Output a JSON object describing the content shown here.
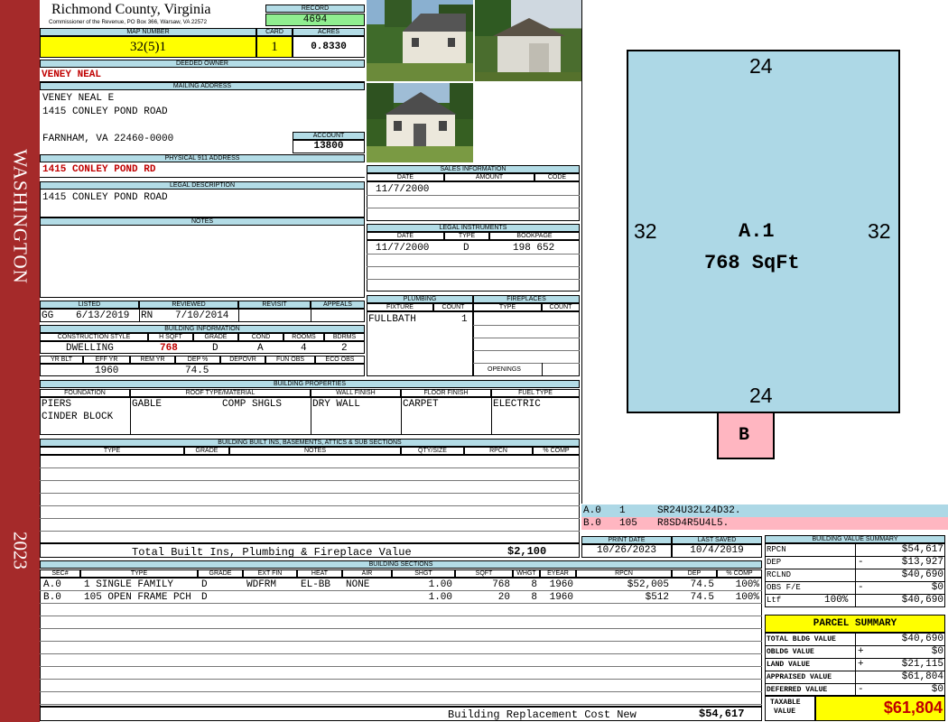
{
  "side": {
    "top": "WASHINGTON",
    "bottom": "2023"
  },
  "header": {
    "county": "Richmond County, Virginia",
    "address_line": "Commissioner of the Revenue, PO Box 366, Warsaw, VA 22572",
    "record_label": "RECORD",
    "record_value": "4694",
    "map_label": "MAP NUMBER",
    "map_value": "32(5)1",
    "card_label": "CARD",
    "card_value": "1",
    "acres_label": "ACRES",
    "acres_value": "0.8330"
  },
  "owner": {
    "deeded_label": "DEEDED OWNER",
    "deeded_value": "VENEY NEAL",
    "mailing_label": "MAILING ADDRESS",
    "mail_line1": "VENEY NEAL E",
    "mail_line2": "1415 CONLEY POND ROAD",
    "mail_line3": "FARNHAM, VA 22460-0000",
    "account_label": "ACCOUNT",
    "account_value": "13800",
    "physical_label": "PHYSICAL 911 ADDRESS",
    "physical_value": "1415 CONLEY POND RD",
    "legal_label": "LEGAL DESCRIPTION",
    "legal_value": "1415 CONLEY POND ROAD",
    "notes_label": "NOTES"
  },
  "listed": {
    "listed_label": "LISTED",
    "reviewed_label": "REVIEWED",
    "revisit_label": "REVISIT",
    "appeals_label": "APPEALS",
    "listed_by": "GG",
    "listed_date": "6/13/2019",
    "reviewed_by": "RN",
    "reviewed_date": "7/10/2014"
  },
  "building_info": {
    "label": "BUILDING INFORMATION",
    "h1": "CONSTRUCTION STYLE",
    "h2": "H SQFT",
    "h3": "GRADE",
    "h4": "COND",
    "h5": "ROOMS",
    "h6": "BDRMS",
    "style": "DWELLING",
    "hsqft": "768",
    "grade": "D",
    "cond": "A",
    "rooms": "4",
    "bdrms": "2",
    "h7": "YR BLT",
    "h8": "EFF YR",
    "h9": "REM YR",
    "h10": "DEP %",
    "h11": "DEPOVR",
    "h12": "FUN OBS",
    "h13": "ECO OBS",
    "eff_yr": "1960",
    "dep": "74.5"
  },
  "sales": {
    "label": "SALES INFORMATION",
    "date_label": "DATE",
    "amount_label": "AMOUNT",
    "code_label": "CODE",
    "date": "11/7/2000"
  },
  "legal_instr": {
    "label": "LEGAL INSTRUMENTS",
    "date_label": "DATE",
    "type_label": "TYPE",
    "book_label": "BOOKPAGE",
    "date": "11/7/2000",
    "type": "D",
    "book": "198 652"
  },
  "plumbing": {
    "label": "PLUMBING",
    "fixture_label": "FIXTURE",
    "count_label": "COUNT",
    "fixture": "FULLBATH",
    "count": "1"
  },
  "fireplaces": {
    "label": "FIREPLACES",
    "type_label": "TYPE",
    "count_label": "COUNT",
    "openings_label": "OPENINGS"
  },
  "bprops": {
    "label": "BUILDING PROPERTIES",
    "foundation_label": "FOUNDATION",
    "roof_label": "ROOF TYPE/MATERIAL",
    "wall_label": "WALL FINISH",
    "floor_label": "FLOOR FINISH",
    "fuel_label": "FUEL TYPE",
    "foundation1": "PIERS",
    "foundation2": "CINDER BLOCK",
    "roof_type": "GABLE",
    "roof_mat": "COMP SHGLS",
    "wall": "DRY WALL",
    "floor": "CARPET",
    "fuel": "ELECTRIC"
  },
  "builtins": {
    "label": "BUILDING BUILT INS, BASEMENTS, ATTICS & SUB SECTIONS",
    "type_label": "TYPE",
    "grade_label": "GRADE",
    "notes_label": "NOTES",
    "qty_label": "QTY/SIZE",
    "rpcn_label": "RPCN",
    "comp_label": "% COMP",
    "total_label": "Total Built Ins, Plumbing & Fireplace Value",
    "total_value": "$2,100"
  },
  "dates": {
    "print_label": "PRINT DATE",
    "saved_label": "LAST SAVED",
    "print_value": "10/26/2023",
    "saved_value": "10/4/2019"
  },
  "sections": {
    "label": "BUILDING SECTIONS",
    "headers": [
      "SEC#",
      "TYPE",
      "GRADE",
      "EXT FIN",
      "HEAT",
      "AIR",
      "SHGT",
      "SQFT",
      "WHGT",
      "EYEAR",
      "RPCN",
      "DEP",
      "% COMP"
    ],
    "rows": [
      {
        "sec": "A.0",
        "type": "1 SINGLE FAMILY",
        "grade": "D",
        "ext": "WDFRM",
        "heat": "EL-BB",
        "air": "NONE",
        "shgt": "1.00",
        "sqft": "768",
        "whgt": "8",
        "eyear": "1960",
        "rpcn": "$52,005",
        "dep": "74.5",
        "comp": "100%"
      },
      {
        "sec": "B.0",
        "type": "105 OPEN FRAME PCH",
        "grade": "D",
        "ext": "",
        "heat": "",
        "air": "",
        "shgt": "1.00",
        "sqft": "20",
        "whgt": "8",
        "eyear": "1960",
        "rpcn": "$512",
        "dep": "74.5",
        "comp": "100%"
      }
    ],
    "replacement_label": "Building Replacement Cost New",
    "replacement_value": "$54,617"
  },
  "sketch": {
    "top": "24",
    "bottom": "24",
    "left": "32",
    "right": "32",
    "area_name": "A.1",
    "area_size": "768 SqFt",
    "porch": "B",
    "legend_a_id": "A.0",
    "legend_a_code": "1",
    "legend_a_path": "SR24U32L24D32.",
    "legend_b_id": "B.0",
    "legend_b_code": "105",
    "legend_b_path": "R8SD4R5U4L5.",
    "fill_main": "#add8e6",
    "fill_porch": "#ffb6c1"
  },
  "bvs": {
    "label": "BUILDING VALUE SUMMARY",
    "rpcn_label": "RPCN",
    "rpcn_value": "$54,617",
    "dep_label": "DEP",
    "dep_sign": "-",
    "dep_value": "$13,927",
    "rclnd_label": "RCLND",
    "rclnd_value": "$40,690",
    "obs_label": "OBS F/E",
    "obs_sign": "-",
    "obs_value": "$0",
    "ltf_label": "Ltf",
    "ltf_pct": "100%",
    "ltf_value": "$40,690"
  },
  "parcel": {
    "title": "PARCEL SUMMARY",
    "tbv_label": "TOTAL BLDG VALUE",
    "tbv_value": "$40,690",
    "oblg_label": "OBLDG VALUE",
    "oblg_sign": "+",
    "oblg_value": "$0",
    "land_label": "LAND VALUE",
    "land_sign": "+",
    "land_value": "$21,115",
    "appr_label": "APPRAISED VALUE",
    "appr_value": "$61,804",
    "def_label": "DEFERRED VALUE",
    "def_sign": "-",
    "def_value": "$0",
    "tax_label1": "TAXABLE",
    "tax_label2": "VALUE",
    "tax_value": "$61,804"
  }
}
